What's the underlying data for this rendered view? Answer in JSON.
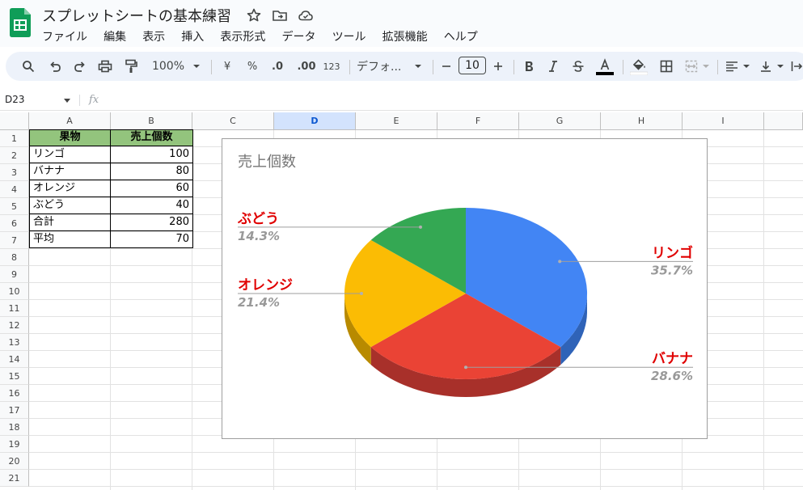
{
  "app": {
    "title": "スプレットシートの基本練習",
    "menu": [
      "ファイル",
      "編集",
      "表示",
      "挿入",
      "表示形式",
      "データ",
      "ツール",
      "拡張機能",
      "ヘルプ"
    ]
  },
  "toolbar": {
    "zoom": "100%",
    "currency": "¥",
    "percent": "%",
    "decrease_decimal": ".0",
    "increase_decimal": ".00",
    "number_format": "123",
    "font": "デフォ...",
    "font_size": "10"
  },
  "formula_bar": {
    "name_box": "D23",
    "fx": "fx",
    "value": ""
  },
  "sheet": {
    "columns": [
      "A",
      "B",
      "C",
      "D",
      "E",
      "F",
      "G",
      "H",
      "I"
    ],
    "selected_column": "D",
    "rows": [
      "1",
      "2",
      "3",
      "4",
      "5",
      "6",
      "7",
      "8",
      "9",
      "10",
      "11",
      "12",
      "13",
      "14",
      "15",
      "16",
      "17",
      "18",
      "19",
      "20",
      "21"
    ],
    "header_fill": "#93c47d",
    "table": {
      "headers": [
        "果物",
        "売上個数"
      ],
      "rows": [
        [
          "リンゴ",
          "100"
        ],
        [
          "バナナ",
          "80"
        ],
        [
          "オレンジ",
          "60"
        ],
        [
          "ぶどう",
          "40"
        ],
        [
          "合計",
          "280"
        ],
        [
          "平均",
          "70"
        ]
      ]
    }
  },
  "chart_data": {
    "type": "pie",
    "style": "3d",
    "title": "売上個数",
    "categories": [
      "リンゴ",
      "バナナ",
      "オレンジ",
      "ぶどう"
    ],
    "values": [
      100,
      80,
      60,
      40
    ],
    "percent_labels": [
      "35.7%",
      "28.6%",
      "21.4%",
      "14.3%"
    ],
    "colors": [
      "#4285f4",
      "#ea4335",
      "#fbbc04",
      "#34a853"
    ],
    "side_colors": [
      "#2f63b8",
      "#a8302a",
      "#b88a00",
      "#23793b"
    ],
    "label_color": "#e00000",
    "percent_color": "#999999"
  }
}
